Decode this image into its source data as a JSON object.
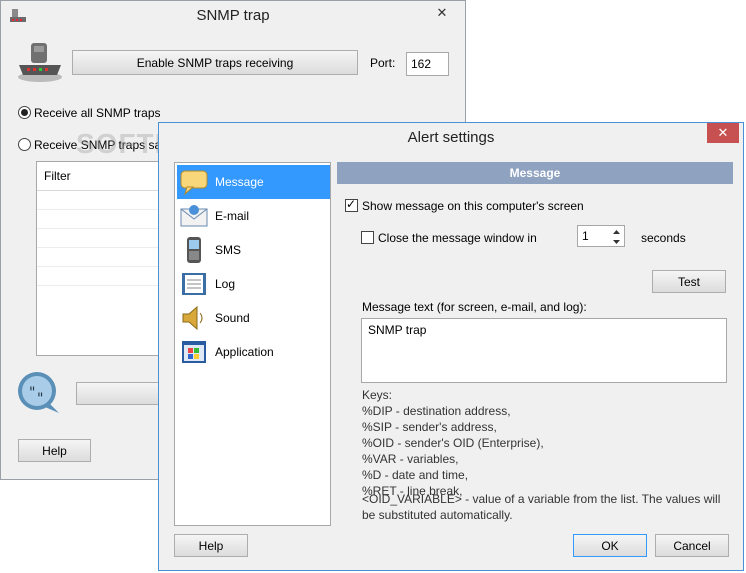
{
  "main_window": {
    "title": "SNMP trap",
    "close_glyph": "✕",
    "enable_button": "Enable SNMP traps receiving",
    "port_label": "Port:",
    "port_value": "162",
    "radio_all": "Receive all SNMP traps",
    "radio_filter": "Receive SNMP traps sati",
    "filter_header": "Filter",
    "help_button": "Help",
    "watermark": "SOFTPEDIA"
  },
  "alert_window": {
    "title": "Alert settings",
    "close_glyph": "✕",
    "nav": [
      {
        "label": "Message",
        "icon": "message-icon"
      },
      {
        "label": "E-mail",
        "icon": "email-icon"
      },
      {
        "label": "SMS",
        "icon": "phone-icon"
      },
      {
        "label": "Log",
        "icon": "log-icon"
      },
      {
        "label": "Sound",
        "icon": "speaker-icon"
      },
      {
        "label": "Application",
        "icon": "application-icon"
      }
    ],
    "section_header": "Message",
    "show_message_label": "Show message on this computer's screen",
    "close_window_label": "Close the message window in",
    "seconds_value": "1",
    "seconds_label": "seconds",
    "test_button": "Test",
    "message_text_label": "Message text (for screen, e-mail, and log):",
    "message_text_value": "SNMP trap",
    "keys": [
      "Keys:",
      "%DIP - destination address,",
      "%SIP - sender's address,",
      "%OID - sender's OID (Enterprise),",
      "%VAR - variables,",
      "%D - date and time,",
      "%RET - line break,",
      "<OID_VARIABLE> - value of a variable from the list. The values will",
      "be substituted automatically."
    ],
    "help_button": "Help",
    "ok_button": "OK",
    "cancel_button": "Cancel"
  },
  "colors": {
    "accent": "#3399ff",
    "close_red": "#c75050",
    "section_header": "#8fa2c0"
  }
}
